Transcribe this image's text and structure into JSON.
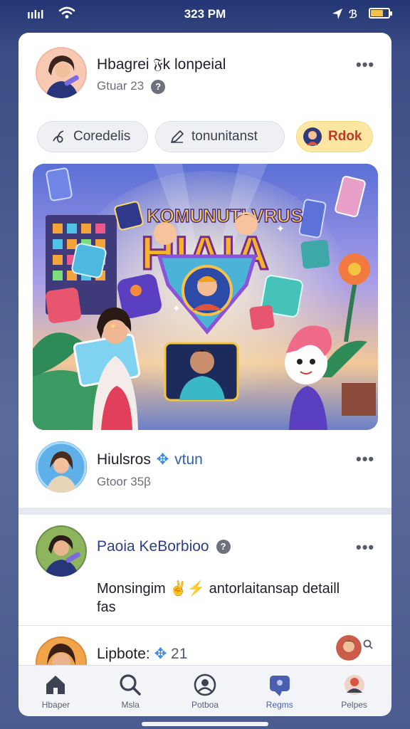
{
  "status_bar": {
    "carrier": "ıılıl",
    "time": "323 PM",
    "bluetooth": "✈ ℬ",
    "battery_level": 0.7
  },
  "post1": {
    "name": "Hbagrei 𝔉k lonpeial",
    "meta": "Gtuar 23",
    "help": "?",
    "more": "•••"
  },
  "chips": [
    {
      "label": "Coredelis",
      "icon": "link-icon"
    },
    {
      "label": "tonunitanst",
      "icon": "pencil-icon"
    },
    {
      "label": "Rdok",
      "icon": "avatar-icon"
    }
  ],
  "hero": {
    "banner_text": "KOMUNUTI VRUS",
    "big_text": "HIAIA"
  },
  "post2": {
    "name": "Hiulsros",
    "name_suffix": "vtun",
    "meta": "Gtoor 35β",
    "more": "•••"
  },
  "post3": {
    "name": "Paoia KeBorbioo",
    "help": "?",
    "more": "•••",
    "text_before": "Monsingim",
    "text_after": "antorlaitansap detaill",
    "text_line2": "fas"
  },
  "post4": {
    "name": "Lipbote:",
    "count": "21"
  },
  "tabs": [
    {
      "label": "Hbaper",
      "icon": "home-icon"
    },
    {
      "label": "Msla",
      "icon": "search-icon"
    },
    {
      "label": "Potboa",
      "icon": "profile-icon"
    },
    {
      "label": "Regms",
      "icon": "messages-icon",
      "active": true
    },
    {
      "label": "Pelpes",
      "icon": "people-icon"
    }
  ],
  "colors": {
    "accent": "#4a5fb0",
    "gold_chip": "#fbe7a1",
    "card": "#ffffff"
  }
}
